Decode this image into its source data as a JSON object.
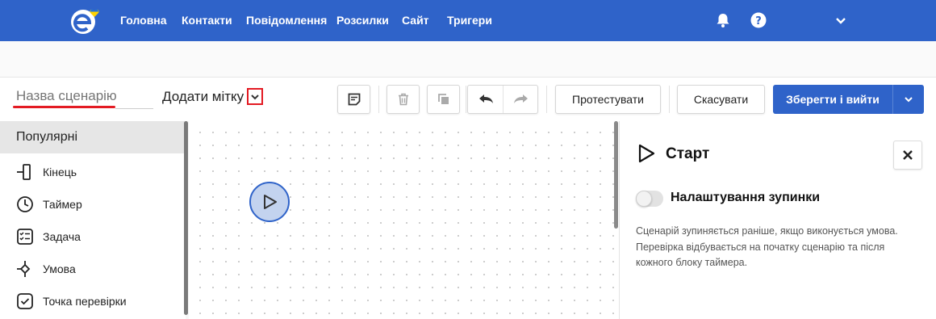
{
  "nav": {
    "logo_icon": "edna-logo-with-ua-heart-icon",
    "items": [
      {
        "label": "Головна"
      },
      {
        "label": "Контакти"
      },
      {
        "label": "Повідомлення"
      },
      {
        "label": "Розсилки"
      },
      {
        "label": "Сайт"
      },
      {
        "label": "Тригери"
      }
    ],
    "bell_icon": "bell-icon",
    "help_icon": "help-circle-icon",
    "account_chevron_icon": "chevron-down-icon"
  },
  "toolbar": {
    "scenario_name_placeholder": "Назва сценарію",
    "scenario_name_value": "",
    "add_tag_label": "Додати мітку",
    "test_label": "Протестувати",
    "cancel_label": "Скасувати",
    "save_exit_label": "Зберегти і вийти"
  },
  "sidebar": {
    "header": "Популярні",
    "items": [
      {
        "label": "Кінець",
        "icon": "end-block-icon"
      },
      {
        "label": "Таймер",
        "icon": "timer-icon"
      },
      {
        "label": "Задача",
        "icon": "task-checklist-icon"
      },
      {
        "label": "Умова",
        "icon": "condition-icon"
      },
      {
        "label": "Точка перевірки",
        "icon": "checkpoint-icon"
      }
    ]
  },
  "canvas": {
    "start_node_icon": "play-icon"
  },
  "panel": {
    "title": "Старт",
    "toggle_label": "Налаштування зупинки",
    "toggle_on": false,
    "description": "Сценарій зупиняється раніше, якщо виконується умова. Перевірка відбувається на початку сценарію та після кожного блоку таймера."
  },
  "colors": {
    "brand_blue": "#2f63c9",
    "highlight_red": "#e31b23"
  }
}
